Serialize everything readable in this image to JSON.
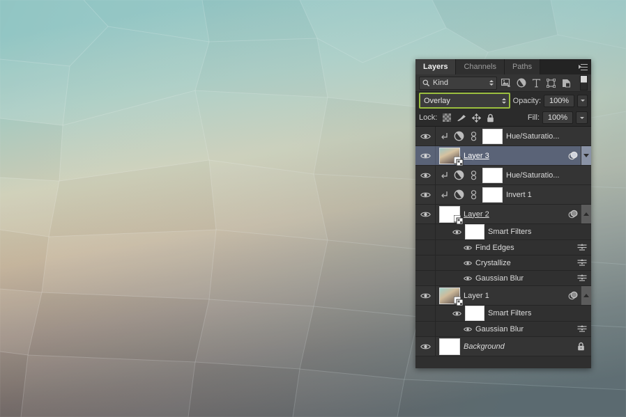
{
  "app": {
    "title": "Photoshop Layers Panel"
  },
  "panel": {
    "tabs": [
      {
        "label": "Layers",
        "active": true
      },
      {
        "label": "Channels",
        "active": false
      },
      {
        "label": "Paths",
        "active": false
      }
    ],
    "menu_icon": "panel-menu-icon",
    "filter": {
      "search_icon": "search-icon",
      "kind_label": "Kind",
      "type_icons": [
        "pixel-layer-icon",
        "adjustment-layer-icon",
        "type-layer-icon",
        "shape-layer-icon",
        "smart-object-icon"
      ],
      "toggle_icon": "filter-toggle-switch"
    },
    "blend": {
      "mode": "Overlay",
      "opacity_label": "Opacity:",
      "opacity_value": "100%",
      "fill_label": "Fill:",
      "fill_value": "100%",
      "highlight_color": "#9bbf3f"
    },
    "lock": {
      "label": "Lock:",
      "icons": [
        "lock-transparency-icon",
        "lock-image-pixels-icon",
        "lock-position-icon",
        "lock-all-icon"
      ]
    }
  },
  "layers": [
    {
      "name": "Hue/Saturatio...",
      "type": "adjustment",
      "visible": true,
      "clipped": true,
      "linked": true,
      "mask": true,
      "selected": false,
      "underline": false
    },
    {
      "name": "Layer 3",
      "type": "smart-object",
      "visible": true,
      "selected": true,
      "underline": true,
      "has_fx": true,
      "disclosure": "down",
      "thumb": "gradient-tan-blue"
    },
    {
      "name": "Hue/Saturatio...",
      "type": "adjustment",
      "visible": true,
      "clipped": true,
      "linked": true,
      "mask": true,
      "selected": false,
      "underline": false
    },
    {
      "name": "Invert 1",
      "type": "adjustment",
      "visible": true,
      "clipped": true,
      "linked": true,
      "mask": true,
      "selected": false,
      "underline": false
    },
    {
      "name": "Layer 2",
      "type": "smart-object",
      "visible": true,
      "selected": false,
      "underline": true,
      "has_fx": true,
      "disclosure": "up",
      "thumb": "white",
      "smart_filters": {
        "label": "Smart Filters",
        "visible": true,
        "filters": [
          {
            "name": "Find Edges",
            "visible": true
          },
          {
            "name": "Crystallize",
            "visible": true
          },
          {
            "name": "Gaussian Blur",
            "visible": true
          }
        ]
      }
    },
    {
      "name": "Layer 1",
      "type": "smart-object",
      "visible": true,
      "selected": false,
      "underline": false,
      "has_fx": true,
      "disclosure": "up",
      "thumb": "gradient-teal-tan",
      "smart_filters": {
        "label": "Smart Filters",
        "visible": true,
        "filters": [
          {
            "name": "Gaussian Blur",
            "visible": true
          }
        ]
      }
    },
    {
      "name": "Background",
      "type": "background",
      "visible": true,
      "selected": false,
      "italic": true,
      "locked": true,
      "thumb": "white"
    }
  ],
  "desktop": {
    "wallpaper": "crystallized-polygon-gradient"
  }
}
